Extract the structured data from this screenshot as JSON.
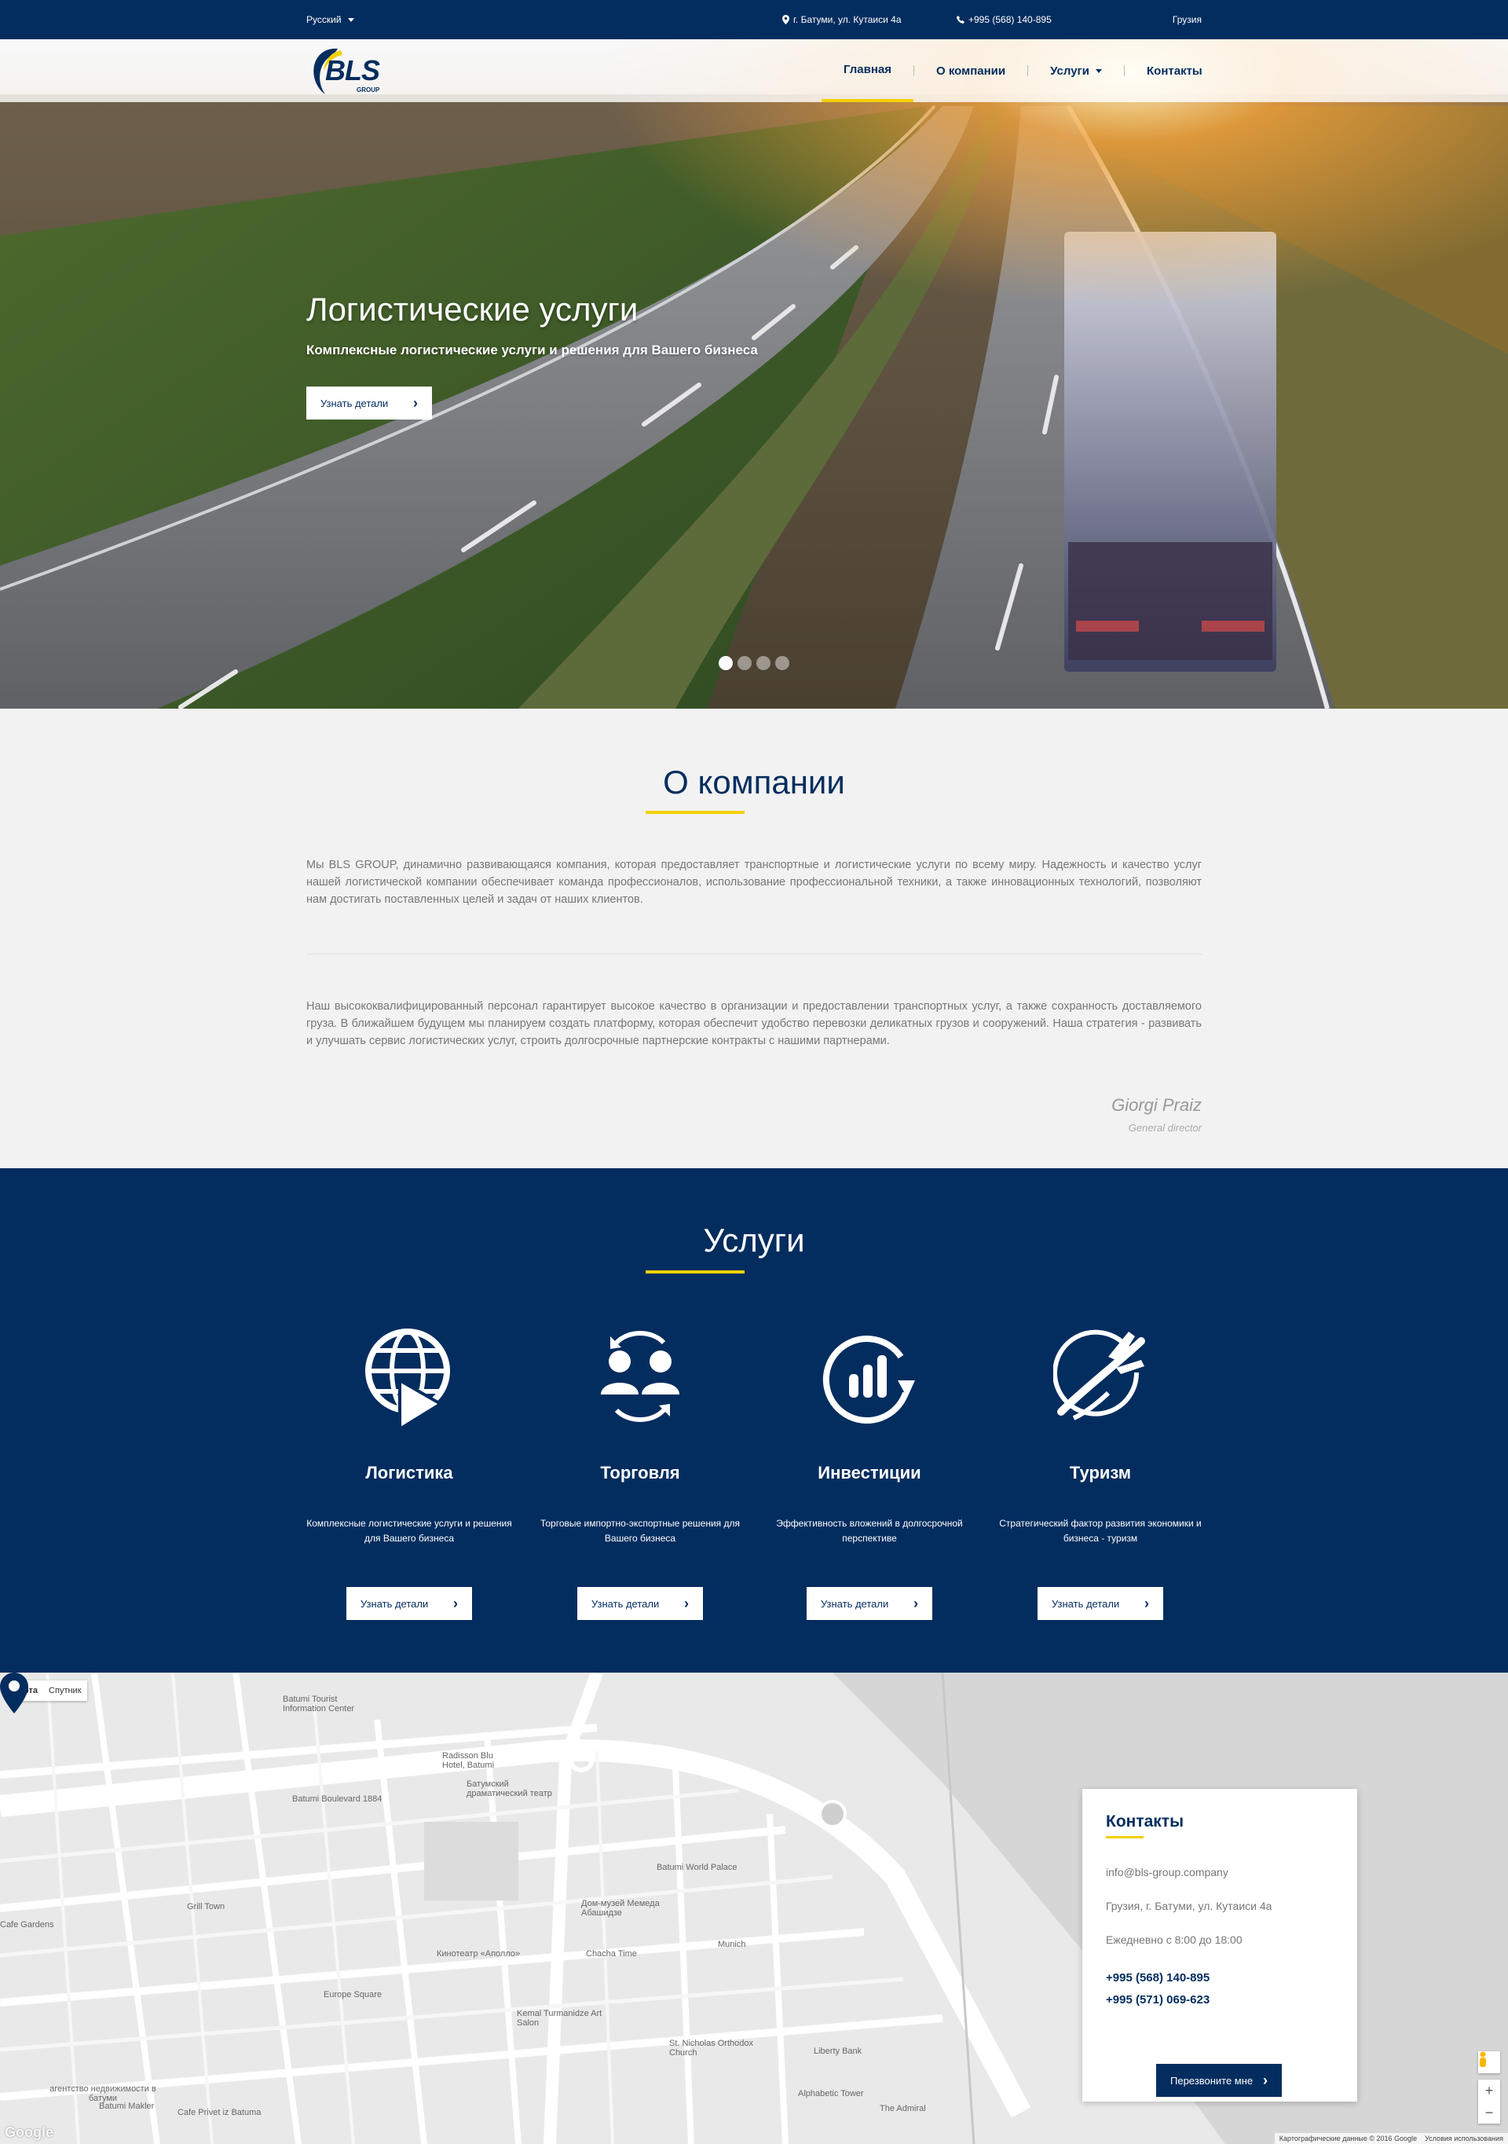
{
  "topbar": {
    "language": "Русский",
    "address": "г. Батуми, ул. Кутаиси 4а",
    "phone": "+995 (568) 140-895",
    "country": "Грузия"
  },
  "logo": {
    "text": "BLS",
    "sub": "GROUP"
  },
  "nav": {
    "items": [
      {
        "label": "Главная",
        "active": true
      },
      {
        "label": "О компании"
      },
      {
        "label": "Услуги",
        "dropdown": true
      },
      {
        "label": "Контакты"
      }
    ]
  },
  "hero": {
    "title": "Логистические услуги",
    "subtitle": "Комплексные логистические услуги и решения для Вашего бизнеса",
    "button": "Узнать детали",
    "slides": 4,
    "active_slide": 1
  },
  "about": {
    "title": "О компании",
    "paragraph1": "Мы BLS GROUP, динамично развивающаяся компания, которая предоставляет транспортные и логистические услуги по всему миру. Надежность и качество услуг нашей логистической компании обеспечивает команда профессионалов, использование профессиональной техники, а также инновационных технологий, позволяют нам достигать поставленных целей и задач от наших клиентов.",
    "paragraph2": "Наш высококвалифицированный персонал гарантирует высокое качество в организации и предоставлении транспортных услуг, а также сохранность доставляемого груза. В ближайшем будущем мы планируем создать платформу, которая обеспечит удобство перевозки деликатных грузов и сооружений. Наша стратегия - развивать и улучшать сервис логистических услуг, строить долгосрочные партнерские контракты с нашими партнерами.",
    "signature_name": "Giorgi Praiz",
    "signature_role": "General director"
  },
  "services": {
    "title": "Услуги",
    "items": [
      {
        "name": "Логистика",
        "desc": "Комплексные логистические услуги и решения для Вашего бизнеса",
        "button": "Узнать детали",
        "icon": "globe-play-icon"
      },
      {
        "name": "Торговля",
        "desc": "Торговые импортно-экспортные решения для Вашего бизнеса",
        "button": "Узнать детали",
        "icon": "people-exchange-icon"
      },
      {
        "name": "Инвестиции",
        "desc": "Эффективность вложений в долгосрочной перспективе",
        "button": "Узнать детали",
        "icon": "growth-chart-icon"
      },
      {
        "name": "Туризм",
        "desc": "Стратегический фактор развития экономики и бизнеса - туризм",
        "button": "Узнать детали",
        "icon": "plane-globe-icon"
      }
    ]
  },
  "map": {
    "type_map": "Карта",
    "type_satellite": "Спутник",
    "labels": {
      "tourist_center": "Batumi Tourist Information Center",
      "radisson": "Radisson Blu Hotel, Batumi",
      "theatre": "Батумский драматический театр",
      "boulevard": "Batumi Boulevard 1884",
      "world_palace": "Batumi World Palace",
      "grill": "Grill Town",
      "cafe_gardens": "Cafe Gardens",
      "museum": "Дом-музей Мемеда Абашидзе",
      "cinema": "Кинотеатр «Аполло»",
      "chacha": "Chacha Time",
      "munich": "Munich",
      "europe": "Europe Square",
      "kemal": "Kemal Turmanidze Art Salon",
      "nicholas": "St. Nicholas Orthodox Church",
      "liberty": "Liberty Bank",
      "alphabetic": "Alphabetic Tower",
      "admiral": "The Admiral",
      "agency": "агентство недвижимости в батуми",
      "makler": "Batumi Makler",
      "cafe_privet": "Cafe Privet iz Batuma"
    },
    "attribution": "Картографические данные © 2016 Google",
    "terms": "Условия использования",
    "google": "Google"
  },
  "contacts": {
    "title": "Контакты",
    "email": "info@bls-group.company",
    "address": "Грузия, г. Батуми, ул. Кутаиси 4а",
    "hours": "Ежедневно с 8:00 до 18:00",
    "phone1": "+995 (568) 140-895",
    "phone2": "+995 (571) 069-623",
    "callback_button": "Перезвоните мне"
  },
  "colors": {
    "primary": "#032d5f",
    "accent": "#f3d000",
    "background": "#f2f2f2"
  }
}
